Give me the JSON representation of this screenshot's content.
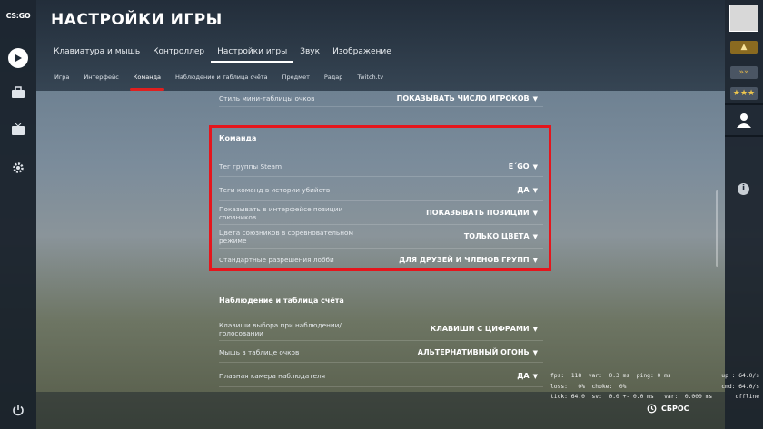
{
  "app": {
    "logo": "CS:GO"
  },
  "header": {
    "title": "НАСТРОЙКИ ИГРЫ",
    "tabs": [
      {
        "label": "Клавиатура и мышь"
      },
      {
        "label": "Контроллер"
      },
      {
        "label": "Настройки игры"
      },
      {
        "label": "Звук"
      },
      {
        "label": "Изображение"
      }
    ],
    "subtabs": [
      {
        "label": "Игра"
      },
      {
        "label": "Интерфейс"
      },
      {
        "label": "Команда"
      },
      {
        "label": "Наблюдение и таблица счёта"
      },
      {
        "label": "Предмет"
      },
      {
        "label": "Радар"
      },
      {
        "label": "Twitch.tv"
      }
    ]
  },
  "content": {
    "prev_row": {
      "label": "Стиль мини-таблицы очков",
      "value": "ПОКАЗЫВАТЬ ЧИСЛО ИГРОКОВ"
    },
    "team_section": {
      "title": "Команда",
      "rows": [
        {
          "label": "Тег группы Steam",
          "value": "E´GO"
        },
        {
          "label": "Теги команд в истории убийств",
          "value": "ДА"
        },
        {
          "label": "Показывать в интерфейсе позиции союзников",
          "value": "ПОКАЗЫВАТЬ ПОЗИЦИИ"
        },
        {
          "label": "Цвета союзников в соревновательном режиме",
          "value": "ТОЛЬКО ЦВЕТА"
        },
        {
          "label": "Стандартные разрешения лобби",
          "value": "ДЛЯ ДРУЗЕЙ И ЧЛЕНОВ ГРУПП"
        }
      ]
    },
    "spectate_section": {
      "title": "Наблюдение и таблица счёта",
      "rows": [
        {
          "label": "Клавиши выбора при наблюдении/голосовании",
          "value": "КЛАВИШИ С ЦИФРАМИ"
        },
        {
          "label": "Мышь в таблице очков",
          "value": "АЛЬТЕРНАТИВНЫЙ ОГОНЬ"
        },
        {
          "label": "Плавная камера наблюдателя",
          "value": "ДА"
        }
      ]
    }
  },
  "footer": {
    "reset_label": "СБРОС"
  },
  "netgraph": {
    "line1": "fps:  118  var:  0.3 ms  ping: 0 ms",
    "line2": "loss:   0%  choke:  0%",
    "line3": "tick: 64.0  sv:  0.0 +- 0.0 ms   var:  0.000 ms",
    "right1": "up : 64.0/s",
    "right2": "cmd: 64.0/s",
    "right3": "offline"
  },
  "colors": {
    "highlight": "#e5151c",
    "tab_underline": "#e01f1f"
  }
}
